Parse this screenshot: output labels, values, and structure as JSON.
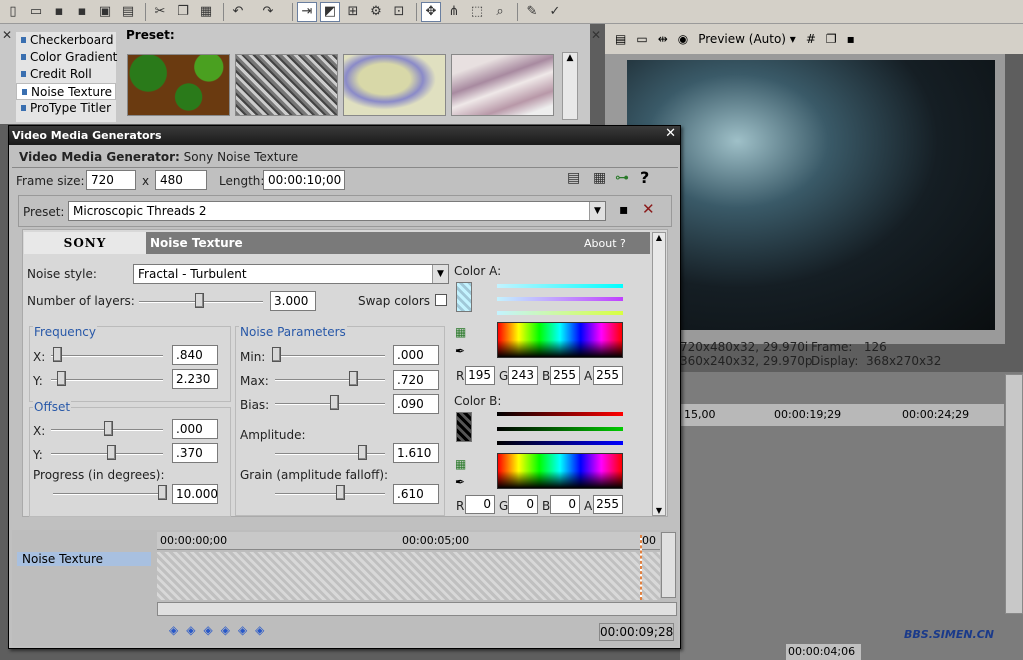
{
  "toolbar": {
    "icons": [
      "new-icon",
      "open-icon",
      "save-icon",
      "save-as-icon",
      "render-icon",
      "properties-icon",
      "cut-icon",
      "copy-icon",
      "paste-icon",
      "undo-icon",
      "redo-icon",
      "snapping-icon",
      "auto-ripple-icon",
      "lock-envelopes-icon",
      "event-fx-icon",
      "selection-tool-icon",
      "normal-edit-tool-icon",
      "envelope-tool-icon",
      "select-tool-icon",
      "zoom-tool-icon",
      "help-icon"
    ]
  },
  "generators": {
    "items": [
      "Checkerboard",
      "Color Gradient",
      "Credit Roll",
      "Noise Texture",
      "ProType Titler"
    ],
    "selected": "Noise Texture",
    "preset_label": "Preset:"
  },
  "preview": {
    "mode": "Preview (Auto)",
    "line1a": "720x480x32, 29.970i",
    "line1b": "Frame:",
    "line1c": "126",
    "line2a": "360x240x32, 29.970p",
    "line2b": "Display:",
    "line2c": "368x270x32"
  },
  "timeline": {
    "ticks": [
      "15,00",
      "00:00:19;29",
      "00:00:24;29"
    ],
    "status_time": "00:00:04;06"
  },
  "dialog": {
    "title": "Video Media Generators",
    "subtitle_bold": "Video Media Generator:",
    "subtitle_rest": "Sony Noise Texture",
    "frame_size_label": "Frame size:",
    "width": "720",
    "x_sep": "x",
    "height": "480",
    "length_label": "Length:",
    "length": "00:00:10;00",
    "preset_label": "Preset:",
    "preset": "Microscopic Threads 2",
    "sony": "SONY",
    "plugin_name": "Noise Texture",
    "about": "About  ?",
    "noise_style_label": "Noise style:",
    "noise_style": "Fractal - Turbulent",
    "layers_label": "Number of layers:",
    "layers": "3.000",
    "swap_label": "Swap colors",
    "freq_label": "Frequency",
    "freq_x_label": "X:",
    "freq_x": ".840",
    "freq_y_label": "Y:",
    "freq_y": "2.230",
    "offset_label": "Offset",
    "off_x_label": "X:",
    "off_x": ".000",
    "off_y_label": "Y:",
    "off_y": ".370",
    "progress_label": "Progress (in degrees):",
    "progress": "10.000",
    "noise_params_label": "Noise Parameters",
    "min_label": "Min:",
    "min": ".000",
    "max_label": "Max:",
    "max": ".720",
    "bias_label": "Bias:",
    "bias": ".090",
    "amplitude_label": "Amplitude:",
    "amplitude": "1.610",
    "grain_label": "Grain (amplitude falloff):",
    "grain": ".610",
    "color_a_label": "Color A:",
    "color_a": {
      "r": "195",
      "g": "243",
      "b": "255",
      "a": "255"
    },
    "color_b_label": "Color B:",
    "color_b": {
      "r": "0",
      "g": "0",
      "b": "0",
      "a": "255"
    },
    "rgba_labels": {
      "r": "R",
      "g": "G",
      "b": "B",
      "a": "A"
    },
    "track_start": "00:00:00;00",
    "track_mid": "00:00:05;00",
    "track_end": "00",
    "track_name": "Noise Texture",
    "end_time": "00:00:09;28"
  },
  "watermark": "BBS.SIMEN.CN"
}
